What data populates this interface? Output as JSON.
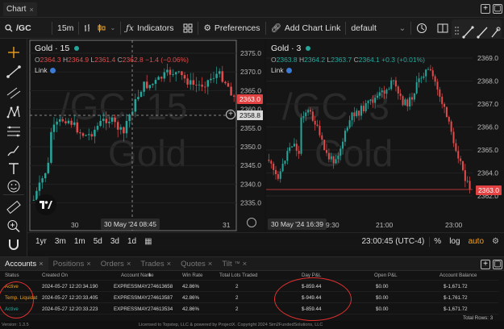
{
  "window": {
    "tab_label": "Chart",
    "tab_close": "×",
    "add_btn": "+",
    "restore_btn": "▢"
  },
  "toolbar": {
    "symbol": "/GC",
    "interval": "15m",
    "indicators_label": "Indicators",
    "preferences_label": "Preferences",
    "add_chart_link_label": "Add Chart Link",
    "layout_select": "default"
  },
  "chart_left": {
    "symbol": "Gold · 15",
    "o": "2364.3",
    "h": "2364.9",
    "l": "2361.4",
    "c": "2362.8",
    "chg": "−1.4 (−0.06%)",
    "link_label": "Link",
    "watermark_top": "/GC, 15",
    "watermark_bottom": "Gold",
    "price_badge": "2363.0",
    "crosshair_price": "2358.8",
    "price_ticks": [
      "2375.0",
      "2370.0",
      "2365.0",
      "2360.0",
      "2355.0",
      "2350.0",
      "2345.0",
      "2340.0",
      "2335.0"
    ],
    "time_ticks": [
      "30",
      "31"
    ],
    "crosshair_time": "30 May '24  08:45"
  },
  "chart_right": {
    "symbol": "Gold · 3",
    "o": "2363.8",
    "h": "2364.2",
    "l": "2363.7",
    "c": "2364.1",
    "chg": "+0.3 (+0.01%)",
    "link_label": "Link",
    "watermark_top": "/GC, 3",
    "watermark_bottom": "Gold",
    "price_badge": "2363.0",
    "price_ticks": [
      "2369.0",
      "2368.0",
      "2367.0",
      "2366.0",
      "2365.0",
      "2364.0",
      "2362.0"
    ],
    "time_ticks": [
      "30 May '24  16:39",
      "9:30",
      "21:00",
      "23:00"
    ]
  },
  "rangebar": {
    "ranges": [
      "1yr",
      "3m",
      "1m",
      "5d",
      "3d",
      "1d"
    ],
    "clock": "23:00:45 (UTC-4)",
    "pct": "%",
    "log": "log",
    "auto": "auto"
  },
  "accounts": {
    "tabs": [
      "Accounts",
      "Positions",
      "Orders",
      "Trades",
      "Quotes",
      "Tilt"
    ],
    "columns": [
      "Status",
      "Created On",
      "Account Name",
      "Win Rate",
      "Total Lots Traded",
      "Day P&L",
      "Open P&L",
      "Account Balance"
    ],
    "rows": [
      {
        "status": "Active",
        "created": "2024-05-27 12:20:34.190",
        "name": "EXPRESSMAY274613658",
        "win": "42.86%",
        "lots": "2",
        "day_pnl": "$-859.44",
        "open_pnl": "$0.00",
        "balance": "$-1,671.72"
      },
      {
        "status": "Temp. Liquidat",
        "created": "2024-05-27 12:20:33.405",
        "name": "EXPRESSMAY274613587",
        "win": "42.86%",
        "lots": "2",
        "day_pnl": "$-949.44",
        "open_pnl": "$0.00",
        "balance": "$-1,761.72"
      },
      {
        "status": "Active",
        "created": "2024-05-27 12:20:33.223",
        "name": "EXPRESSMAY274613534",
        "win": "42.86%",
        "lots": "2",
        "day_pnl": "$-859.44",
        "open_pnl": "$0.00",
        "balance": "$-1,671.72"
      }
    ],
    "total_rows": "Total Rows: 3"
  },
  "footer": {
    "version": "Version: 1.3.5",
    "license": "Licensed to Topstep, LLC & powered by ProjectX. Copyright 2024 Sim2FundedSolutions, LLC"
  },
  "colors": {
    "up": "#26a69a",
    "down": "#e04b4b",
    "accent": "#f0a020",
    "badge": "#e34242"
  }
}
